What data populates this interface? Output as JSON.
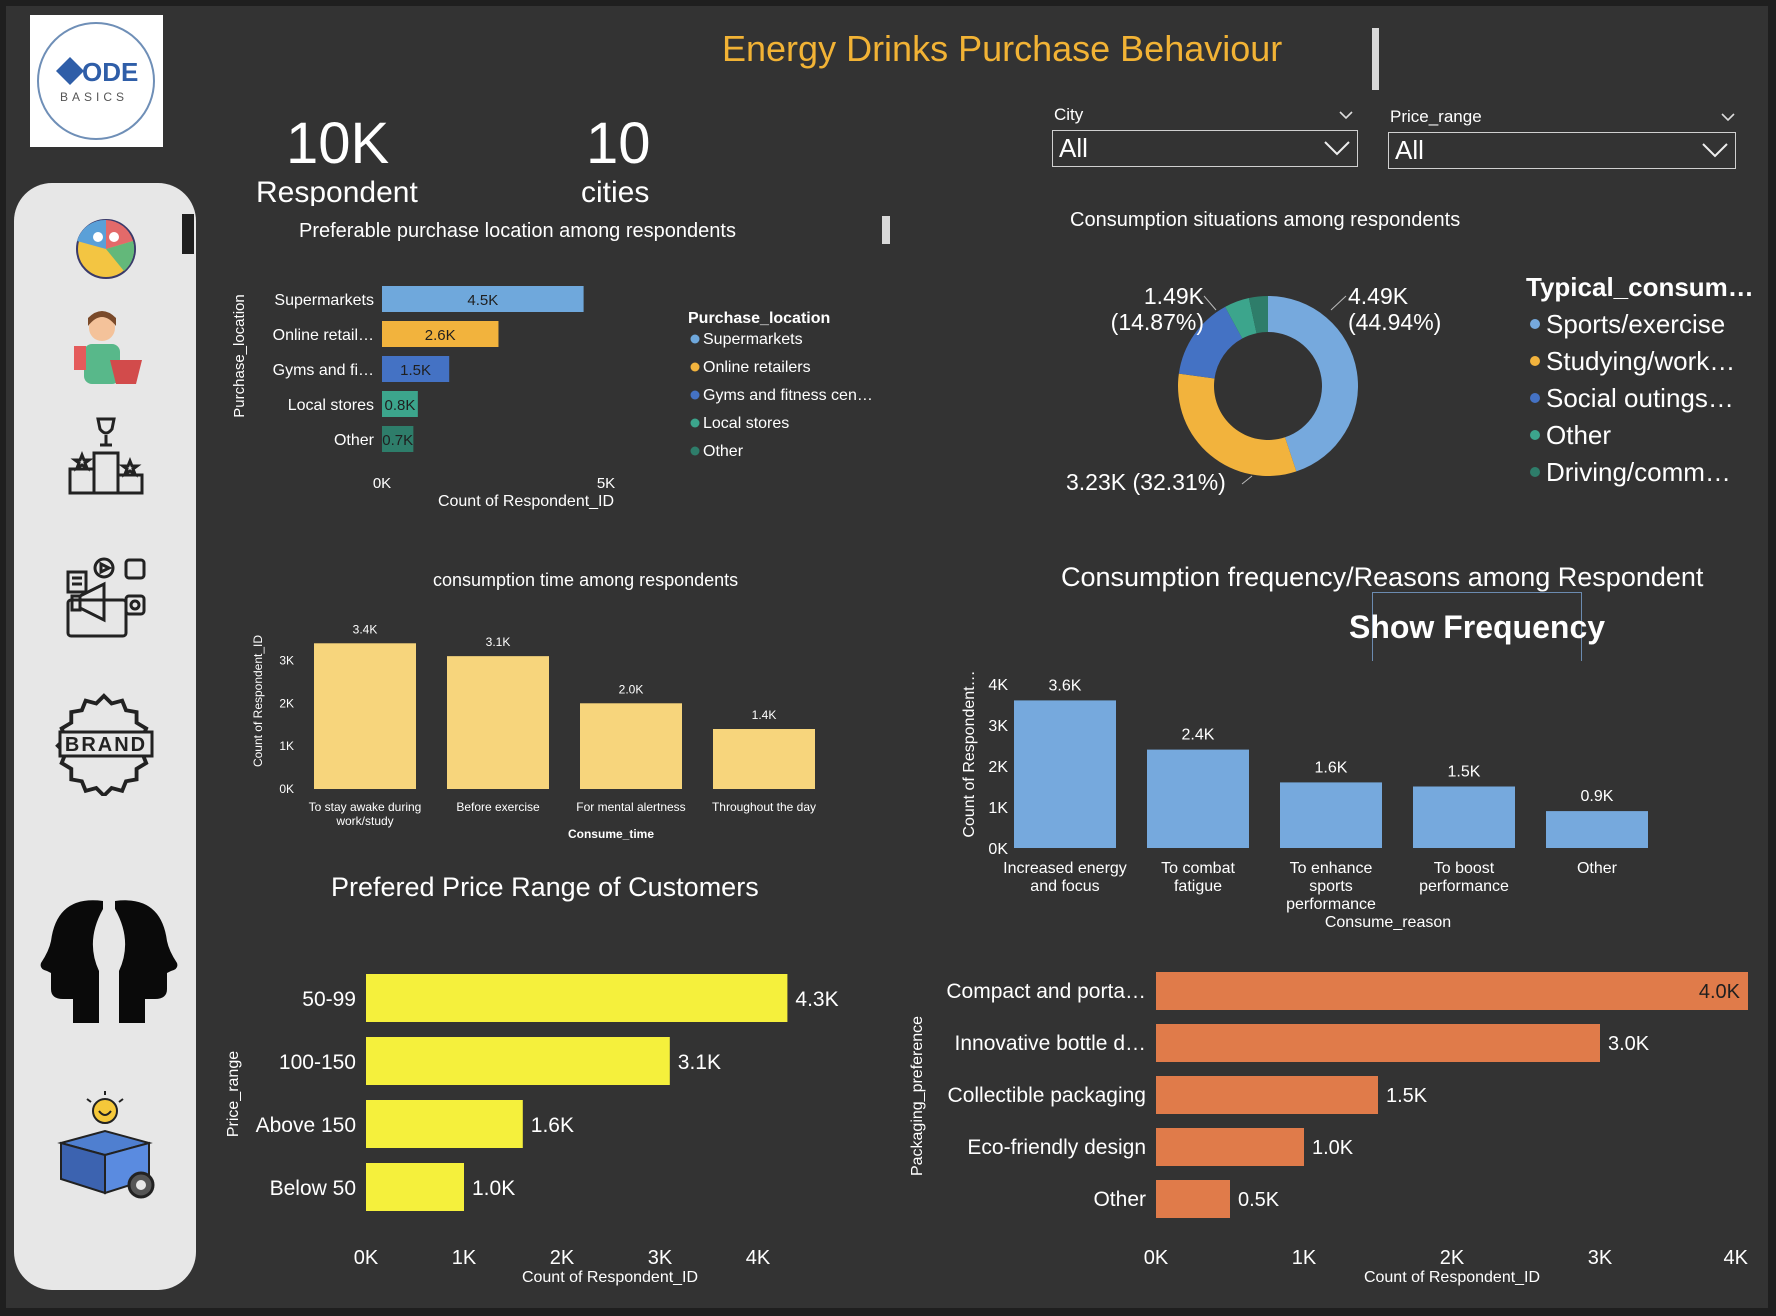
{
  "header": {
    "title": "Energy Drinks  Purchase Behaviour"
  },
  "logo": {
    "text": "ODE",
    "subtitle": "BASICS"
  },
  "kpis": [
    {
      "value": "10K",
      "label": "Respondent"
    },
    {
      "value": "10",
      "label": "cities"
    }
  ],
  "filters": [
    {
      "label": "City",
      "value": "All"
    },
    {
      "label": "Price_range",
      "value": "All"
    }
  ],
  "sidebar": {
    "items": [
      {
        "icon": "demographics-icon"
      },
      {
        "icon": "shopper-icon"
      },
      {
        "icon": "podium-icon"
      },
      {
        "icon": "marketing-icon"
      },
      {
        "icon": "brand-badge-icon"
      },
      {
        "icon": "heads-icon"
      },
      {
        "icon": "product-box-icon"
      }
    ]
  },
  "show_frequency_button": "Show Frequency",
  "colors": {
    "background": "#333333",
    "title": "#f2b335",
    "blue": "#6fa8dc",
    "orange": "#f2b33d",
    "darkblue": "#4472c4",
    "teal": "#3ca58c",
    "darkteal": "#2e7d6a",
    "lightblue2": "#76a9dd",
    "yellow_bar": "#f7d57c",
    "price_bar": "#f5f03c",
    "packaging_bar": "#e07b4a"
  },
  "chart_data": [
    {
      "id": "purchase_location",
      "type": "bar",
      "title": "Preferable purchase location among respondents",
      "categories": [
        "Supermarkets",
        "Online retail…",
        "Gyms and fi…",
        "Local stores",
        "Other"
      ],
      "values": [
        4.5,
        2.6,
        1.5,
        0.8,
        0.7
      ],
      "data_labels": [
        "4.5K",
        "2.6K",
        "1.5K",
        "0.8K",
        "0.7K"
      ],
      "xlabel": "Count of Respondent_ID",
      "ylabel": "Purchase_location",
      "x_ticks": [
        "0K",
        "5K"
      ],
      "xlim": [
        0,
        5
      ],
      "unit": "K",
      "legend": {
        "title": "Purchase_location",
        "items": [
          "Supermarkets",
          "Online retailers",
          "Gyms and fitness cen…",
          "Local stores",
          "Other"
        ]
      }
    },
    {
      "id": "consumption_situations",
      "type": "pie",
      "title": "Consumption situations among respondents",
      "legend": {
        "title": "Typical_consum…",
        "items": [
          "Sports/exercise",
          "Studying/work…",
          "Social outings…",
          "Other",
          "Driving/comm…"
        ]
      },
      "values": [
        4.49,
        3.23,
        1.49,
        0.45,
        0.34
      ],
      "data_labels": [
        "4.49K (44.94%)",
        "3.23K (32.31%)",
        "1.49K (14.87%)"
      ]
    },
    {
      "id": "consumption_time",
      "type": "bar",
      "title": "consumption time among respondents",
      "categories": [
        "To stay awake during work/study",
        "Before exercise",
        "For mental alertness",
        "Throughout the day"
      ],
      "values": [
        3.4,
        3.1,
        2.0,
        1.4
      ],
      "data_labels": [
        "3.4K",
        "3.1K",
        "2.0K",
        "1.4K"
      ],
      "xlabel": "Consume_time",
      "ylabel": "Count of Respondent_ID",
      "y_ticks": [
        "0K",
        "1K",
        "2K",
        "3K"
      ],
      "ylim": [
        0,
        3.5
      ]
    },
    {
      "id": "consumption_reasons",
      "type": "bar",
      "title": "Consumption frequency/Reasons among Respondent",
      "categories": [
        "Increased energy and focus",
        "To combat fatigue",
        "To enhance sports performance",
        "To boost performance",
        "Other"
      ],
      "values": [
        3.6,
        2.4,
        1.6,
        1.5,
        0.9
      ],
      "data_labels": [
        "3.6K",
        "2.4K",
        "1.6K",
        "1.5K",
        "0.9K"
      ],
      "xlabel": "Consume_reason",
      "ylabel": "Count of Respondent…",
      "y_ticks": [
        "0K",
        "1K",
        "2K",
        "3K",
        "4K"
      ],
      "ylim": [
        0,
        4
      ]
    },
    {
      "id": "price_range",
      "type": "bar",
      "title": "Prefered Price Range of Customers",
      "categories": [
        "50-99",
        "100-150",
        "Above 150",
        "Below 50"
      ],
      "values": [
        4.3,
        3.1,
        1.6,
        1.0
      ],
      "data_labels": [
        "4.3K",
        "3.1K",
        "1.6K",
        "1.0K"
      ],
      "xlabel": "Count of Respondent_ID",
      "ylabel": "Price_range",
      "x_ticks": [
        "0K",
        "1K",
        "2K",
        "3K",
        "4K"
      ],
      "xlim": [
        0,
        4
      ]
    },
    {
      "id": "packaging",
      "type": "bar",
      "title": "",
      "categories": [
        "Compact and porta…",
        "Innovative bottle d…",
        "Collectible packaging",
        "Eco-friendly design",
        "Other"
      ],
      "values": [
        4.0,
        3.0,
        1.5,
        1.0,
        0.5
      ],
      "data_labels": [
        "4.0K",
        "3.0K",
        "1.5K",
        "1.0K",
        "0.5K"
      ],
      "xlabel": "Count of Respondent_ID",
      "ylabel": "Packaging_preference",
      "x_ticks": [
        "0K",
        "1K",
        "2K",
        "3K",
        "4K"
      ],
      "xlim": [
        0,
        4
      ]
    }
  ]
}
